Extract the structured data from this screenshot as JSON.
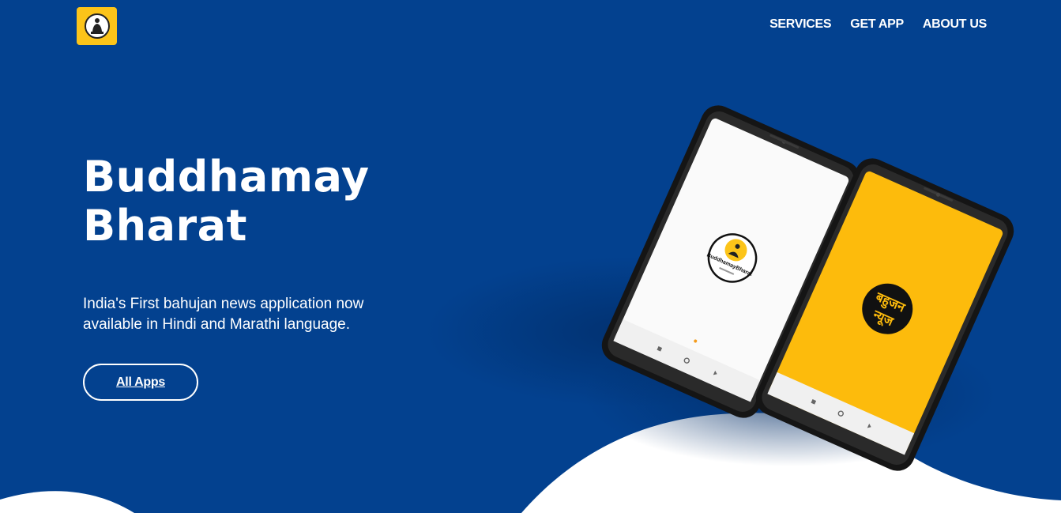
{
  "nav": {
    "items": [
      {
        "label": "SERVICES"
      },
      {
        "label": "GET APP"
      },
      {
        "label": "ABOUT US"
      }
    ]
  },
  "hero": {
    "title_line1": "Buddhamay",
    "title_line2": "Bharat",
    "subtitle": "India's First bahujan news application now available in Hindi and Marathi language.",
    "cta_label": "All Apps"
  },
  "phones": {
    "left_logo_text": "BuddhamayBharat",
    "right_logo_line1": "बहुजन",
    "right_logo_line2": "न्यूज"
  },
  "colors": {
    "background": "#03418f",
    "accent": "#fcc419",
    "wave": "#ffffff"
  },
  "icons": {
    "logo": "buddha-statue-icon"
  }
}
